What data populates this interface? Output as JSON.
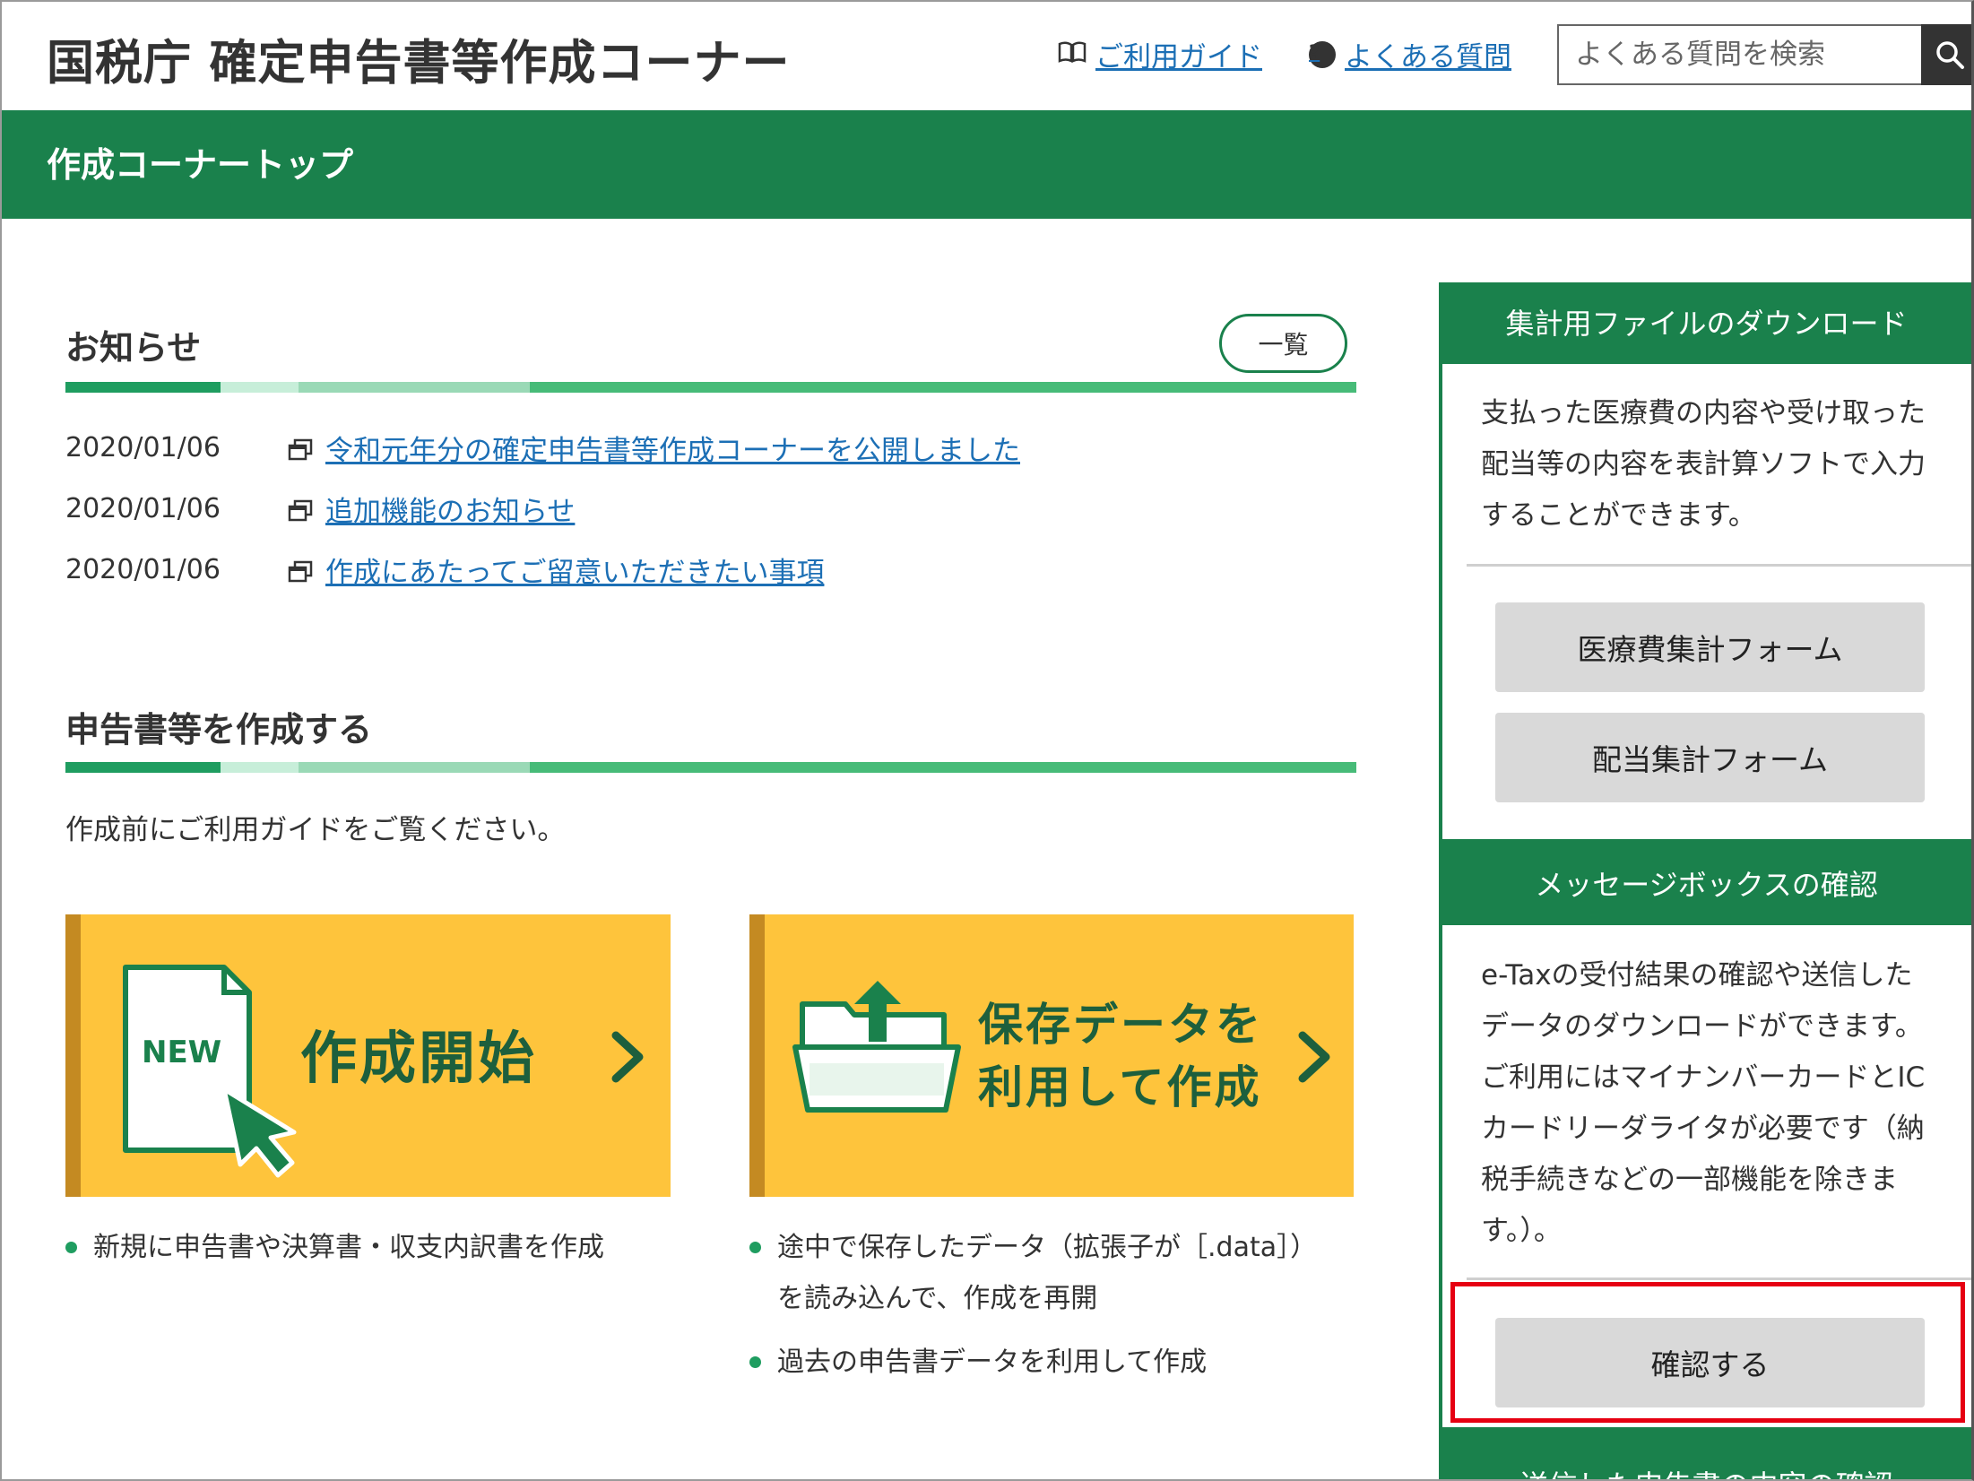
{
  "header": {
    "title": "国税庁 確定申告書等作成コーナー",
    "guide_link": "ご利用ガイド",
    "faq_link": "よくある質問",
    "search_placeholder": "よくある質問を検索"
  },
  "band": {
    "title": "作成コーナートップ"
  },
  "news": {
    "title": "お知らせ",
    "more_label": "一覧",
    "items": [
      {
        "date": "2020/01/06",
        "text": "令和元年分の確定申告書等作成コーナーを公開しました"
      },
      {
        "date": "2020/01/06",
        "text": "追加機能のお知らせ"
      },
      {
        "date": "2020/01/06",
        "text": "作成にあたってご留意いただきたい事項"
      }
    ]
  },
  "create": {
    "title": "申告書等を作成する",
    "intro": "作成前にご利用ガイドをご覧ください。",
    "start_button": {
      "badge": "NEW",
      "label": "作成開始"
    },
    "saved_button": {
      "label_line1": "保存データを",
      "label_line2": "利用して作成"
    },
    "start_bullets": [
      "新規に申告書や決算書・収支内訳書を作成"
    ],
    "saved_bullets": [
      {
        "line1": "途中で保存したデータ（拡張子が［.data］）",
        "line2": "を読み込んで、作成を再開"
      },
      {
        "line1": "過去の申告書データを利用して作成"
      }
    ]
  },
  "sidebar": {
    "download": {
      "title": "集計用ファイルのダウンロード",
      "desc": [
        "支払った医療費の内容や受け取った",
        "配当等の内容を表計算ソフトで入力",
        "することができます。"
      ],
      "buttons": [
        "医療費集計フォーム",
        "配当集計フォーム"
      ]
    },
    "messagebox": {
      "title": "メッセージボックスの確認",
      "desc": [
        "e-Taxの受付結果の確認や送信した",
        "データのダウンロードができます。",
        "ご利用にはマイナンバーカードとIC",
        "カードリーダライタが必要です（納",
        "税手続きなどの一部機能を除きま",
        "す。）。"
      ],
      "button": "確認する"
    },
    "next_title": "送信した申告書の内容の確認"
  },
  "colors": {
    "brand_green": "#1a814c",
    "accent_yellow": "#fec43c",
    "link_blue": "#1c6fb5",
    "highlight_red": "#e60012"
  }
}
